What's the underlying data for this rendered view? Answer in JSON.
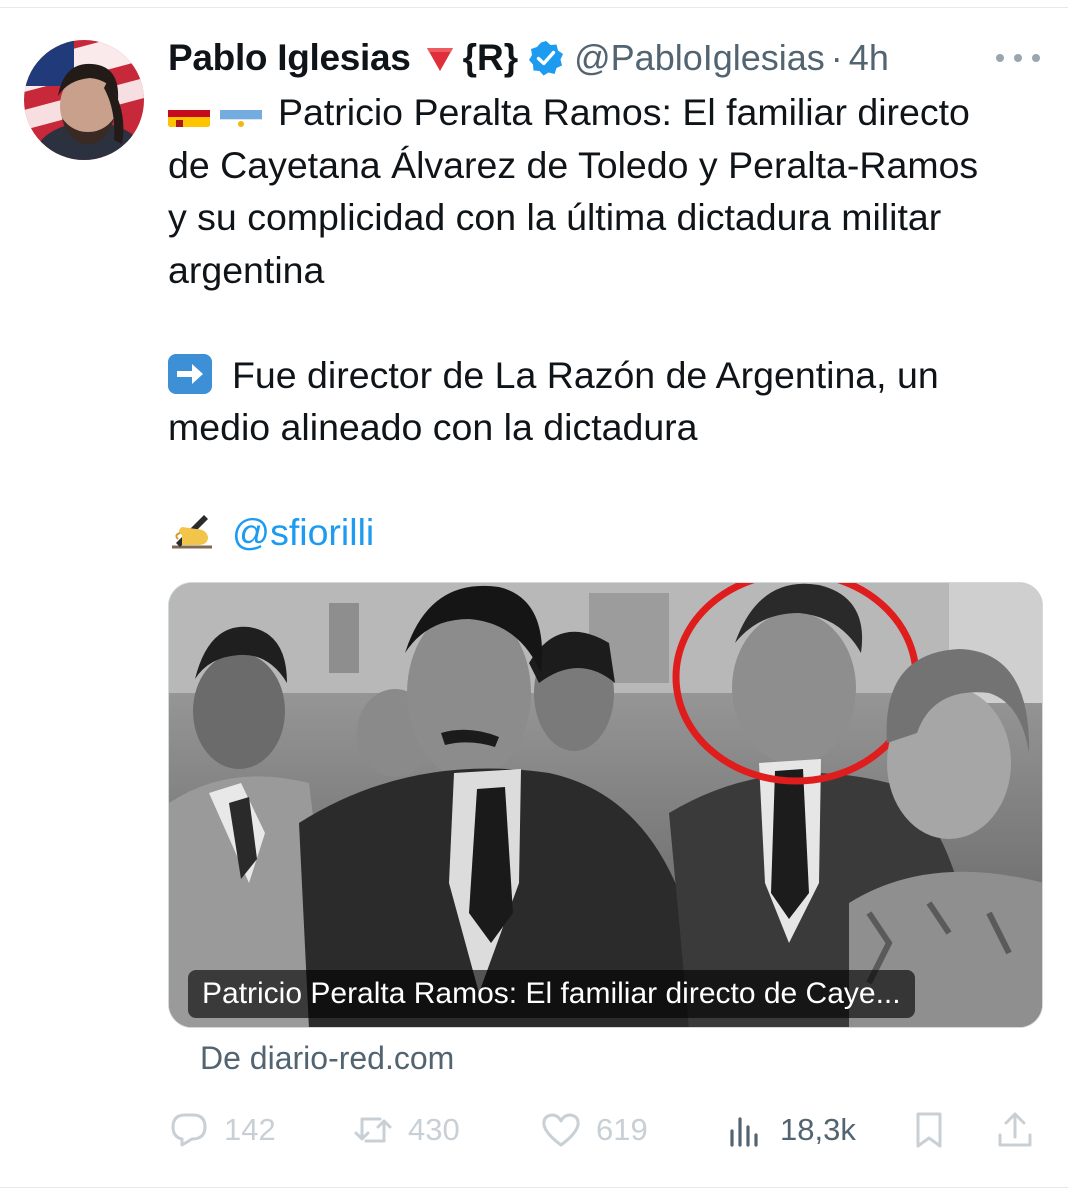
{
  "author": {
    "name": "Pablo Iglesias",
    "tag": "{R}",
    "handle": "@PabloIglesias",
    "separator": "·",
    "time": "4h"
  },
  "tweet": {
    "line1": "Patricio Peralta Ramos: El familiar directo",
    "line2": "de Cayetana Álvarez de Toledo y Peralta-Ramos",
    "line3": "y su complicidad con la última dictadura militar",
    "line4": "argentina",
    "line5": "Fue director de La Razón de Argentina, un",
    "line6": "medio alineado con la dictadura",
    "mention": "@sfiorilli"
  },
  "card": {
    "caption": "Patricio Peralta Ramos: El familiar directo de Caye...",
    "source": "De diario-red.com"
  },
  "actions": {
    "replies": "142",
    "reposts": "430",
    "likes": "619",
    "views": "18,3k"
  },
  "icons": [
    "red-triangle-icon",
    "verified-badge-icon",
    "more-icon",
    "spain-flag-icon",
    "argentina-flag-icon",
    "right-arrow-icon",
    "writing-hand-icon",
    "reply-icon",
    "repost-icon",
    "like-icon",
    "views-icon",
    "bookmark-icon",
    "share-icon"
  ],
  "colors": {
    "verified": "#1d9bf0",
    "mention": "#1d9bf0",
    "muted_text": "#536471"
  }
}
